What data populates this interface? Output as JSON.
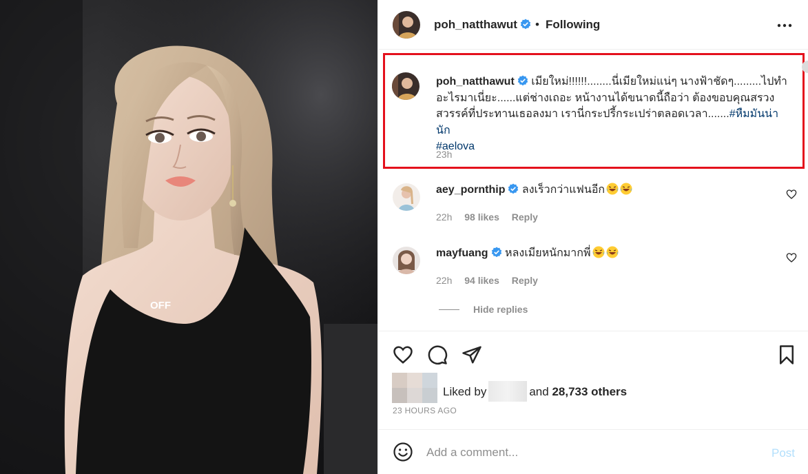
{
  "photo": {
    "shirt_text": "OFF"
  },
  "post": {
    "author": "poh_natthawut",
    "follow_separator": "•",
    "follow_status": "Following",
    "more_icon": "more-horizontal-icon"
  },
  "caption": {
    "username": "poh_natthawut",
    "text": "เมียใหม่!!!!!!........นี่เมียใหม่แน่ๆ นางฟ้าชัดๆ.........ไปทำอะไรมาเนี่ยะ......แต่ช่างเถอะ หน้างานได้ขนาดนี้ถือว่า ต้องขอบคุณสรวงสวรรค์ที่ประทานเธอลงมา เรานี่กระปรี้กระเปร่าตลอดเวลา.......",
    "hashtag1": "#หืมมันน่านัก",
    "hashtag2": "#aelova",
    "time": "23h",
    "highlight_color": "#e4101c"
  },
  "comments": [
    {
      "username": "aey_pornthip",
      "text": "ลงเร็วกว่าแฟนอีก",
      "emoji": "laughing-tears-emoji",
      "time": "22h",
      "likes": "98 likes",
      "reply": "Reply"
    },
    {
      "username": "mayfuang",
      "text": "หลงเมียหนักมากพี่",
      "emoji": "laughing-tears-emoji",
      "time": "22h",
      "likes": "94 likes",
      "reply": "Reply"
    }
  ],
  "hide_replies": "Hide replies",
  "actions": {
    "like_icon": "heart-icon",
    "comment_icon": "comment-bubble-icon",
    "share_icon": "paper-plane-icon",
    "save_icon": "bookmark-icon"
  },
  "likes": {
    "prefix": "Liked by",
    "middle": "and",
    "count": "28,733 others"
  },
  "post_time": "23 HOURS AGO",
  "comment_input": {
    "placeholder": "Add a comment...",
    "value": "",
    "post_label": "Post",
    "emoji_icon": "smiley-face-icon"
  },
  "colors": {
    "verified": "#3897f0",
    "link": "#00376b",
    "secondary_text": "#8e8e8e",
    "post_disabled": "#b2dffc"
  }
}
